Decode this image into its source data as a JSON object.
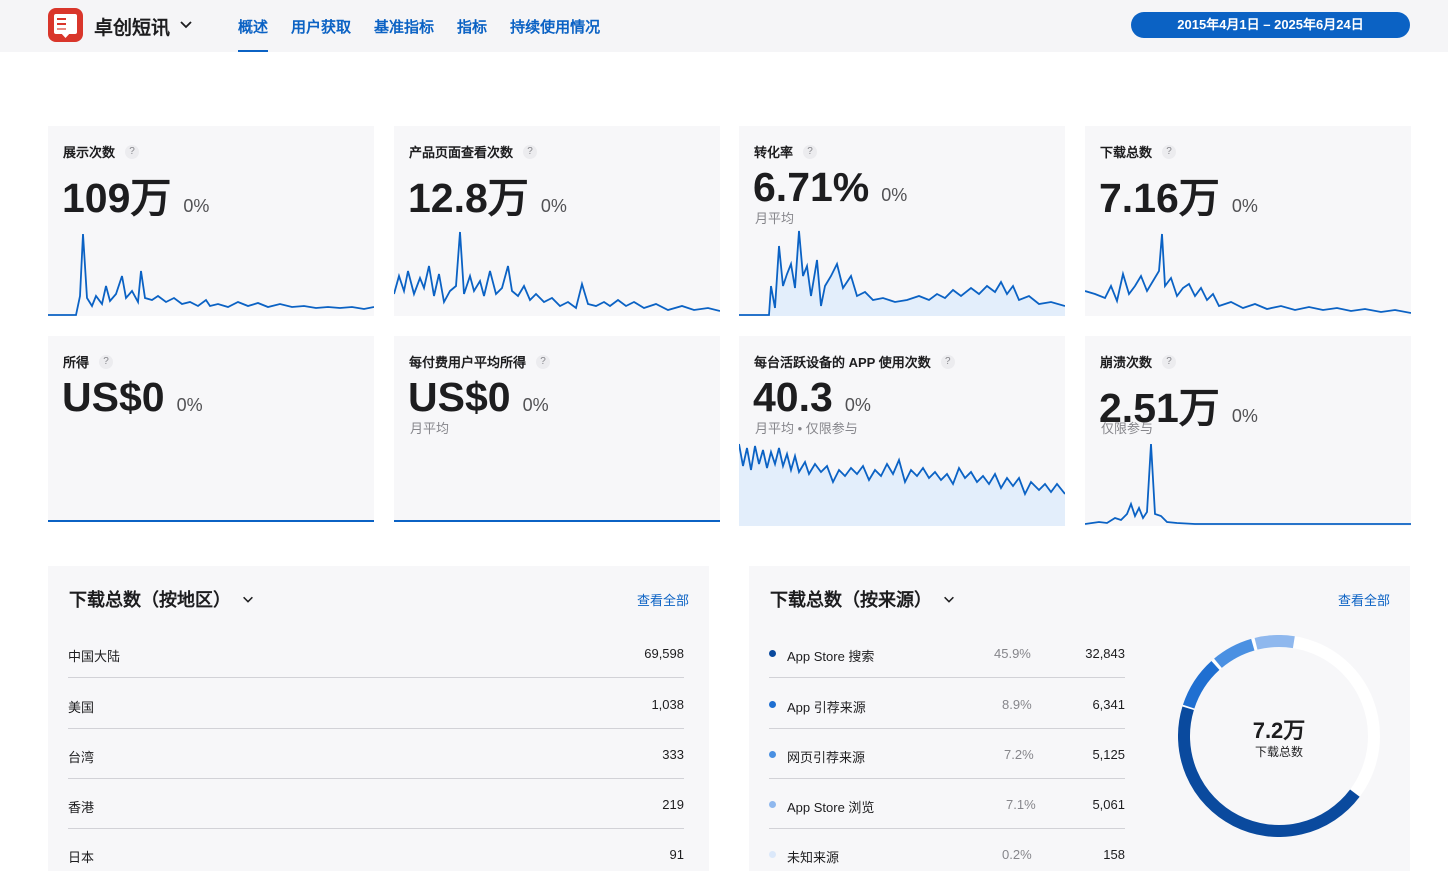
{
  "header": {
    "app_name": "卓创短讯",
    "nav": [
      "概述",
      "用户获取",
      "基准指标",
      "指标",
      "持续使用情况"
    ],
    "active_nav": "概述",
    "date_range": "2015年4月1日 – 2025年6月24日"
  },
  "colors": {
    "accent": "#0b62c4",
    "card_bg": "#f7f7f9"
  },
  "metrics": [
    {
      "title": "展示次数",
      "value": "109万",
      "delta": "0%",
      "sub": ""
    },
    {
      "title": "产品页面查看次数",
      "value": "12.8万",
      "delta": "0%",
      "sub": ""
    },
    {
      "title": "转化率",
      "value": "6.71%",
      "delta": "0%",
      "sub": "月平均"
    },
    {
      "title": "下载总数",
      "value": "7.16万",
      "delta": "0%",
      "sub": ""
    },
    {
      "title": "所得",
      "value": "US$0",
      "delta": "0%",
      "sub": ""
    },
    {
      "title": "每付费用户平均所得",
      "value": "US$0",
      "delta": "0%",
      "sub": "月平均"
    },
    {
      "title": "每台活跃设备的 APP 使用次数",
      "value": "40.3",
      "delta": "0%",
      "sub": "月平均 • 仅限参与"
    },
    {
      "title": "崩溃次数",
      "value": "2.51万",
      "delta": "0%",
      "sub": "仅限参与"
    }
  ],
  "tooltip_icon": "?",
  "region_panel": {
    "title": "下载总数（按地区）",
    "view_all": "查看全部",
    "rows": [
      {
        "label": "中国大陆",
        "value": "69,598"
      },
      {
        "label": "美国",
        "value": "1,038"
      },
      {
        "label": "台湾",
        "value": "333"
      },
      {
        "label": "香港",
        "value": "219"
      },
      {
        "label": "日本",
        "value": "91"
      }
    ]
  },
  "source_panel": {
    "title": "下载总数（按来源）",
    "view_all": "查看全部",
    "rows": [
      {
        "label": "App Store 搜索",
        "pct": "45.9%",
        "value": "32,843",
        "color": "#0a4a9e"
      },
      {
        "label": "App 引荐来源",
        "pct": "8.9%",
        "value": "6,341",
        "color": "#1f6fd1"
      },
      {
        "label": "网页引荐来源",
        "pct": "7.2%",
        "value": "5,125",
        "color": "#4a90e2"
      },
      {
        "label": "App Store 浏览",
        "pct": "7.1%",
        "value": "5,061",
        "color": "#8fb8ee"
      },
      {
        "label": "未知来源",
        "pct": "0.2%",
        "value": "158",
        "color": "#dbe8fa"
      }
    ],
    "donut_value": "7.2万",
    "donut_label": "下载总数"
  }
}
